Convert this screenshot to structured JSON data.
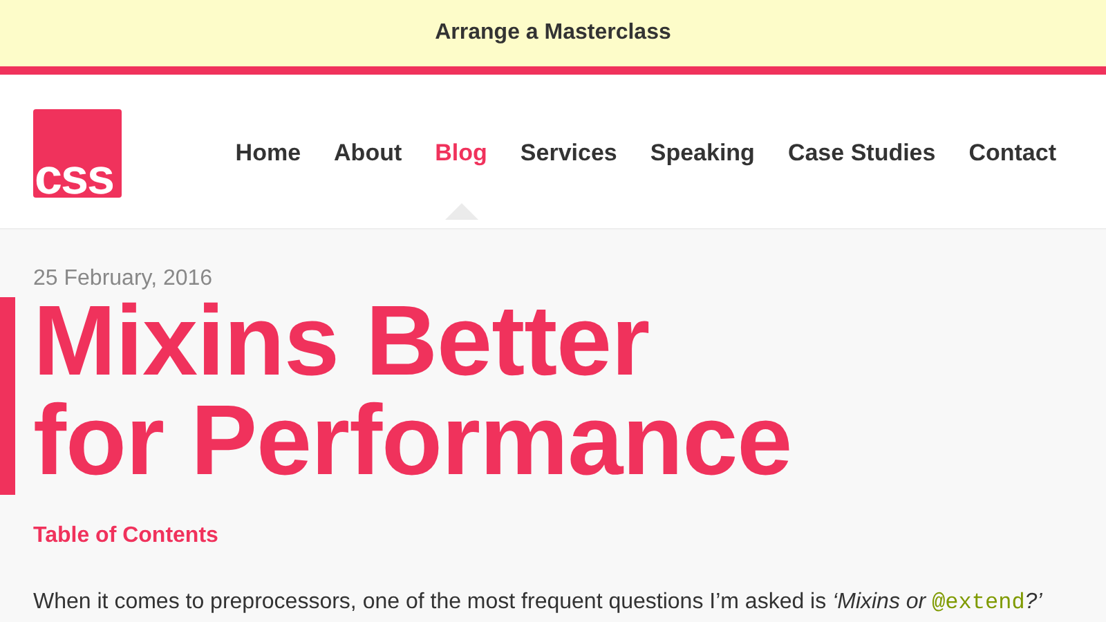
{
  "banner": {
    "label": "Arrange a Masterclass"
  },
  "logo": {
    "text": "css"
  },
  "nav": [
    {
      "label": "Home",
      "selected": false
    },
    {
      "label": "About",
      "selected": false
    },
    {
      "label": "Blog",
      "selected": true
    },
    {
      "label": "Services",
      "selected": false
    },
    {
      "label": "Speaking",
      "selected": false
    },
    {
      "label": "Case Studies",
      "selected": false
    },
    {
      "label": "Contact",
      "selected": false
    }
  ],
  "article": {
    "date": "25 February, 2016",
    "title_lines": [
      "Mixins Better",
      "for Performance"
    ],
    "toc_link": "Table of Contents",
    "intro": [
      {
        "kind": "text",
        "text": "When it comes to preprocessors, one of the most frequent questions I’m asked is "
      },
      {
        "kind": "italic",
        "text": "‘Mixins or "
      },
      {
        "kind": "code",
        "text": "@extend"
      },
      {
        "kind": "italic",
        "text": "?’"
      }
    ]
  }
}
